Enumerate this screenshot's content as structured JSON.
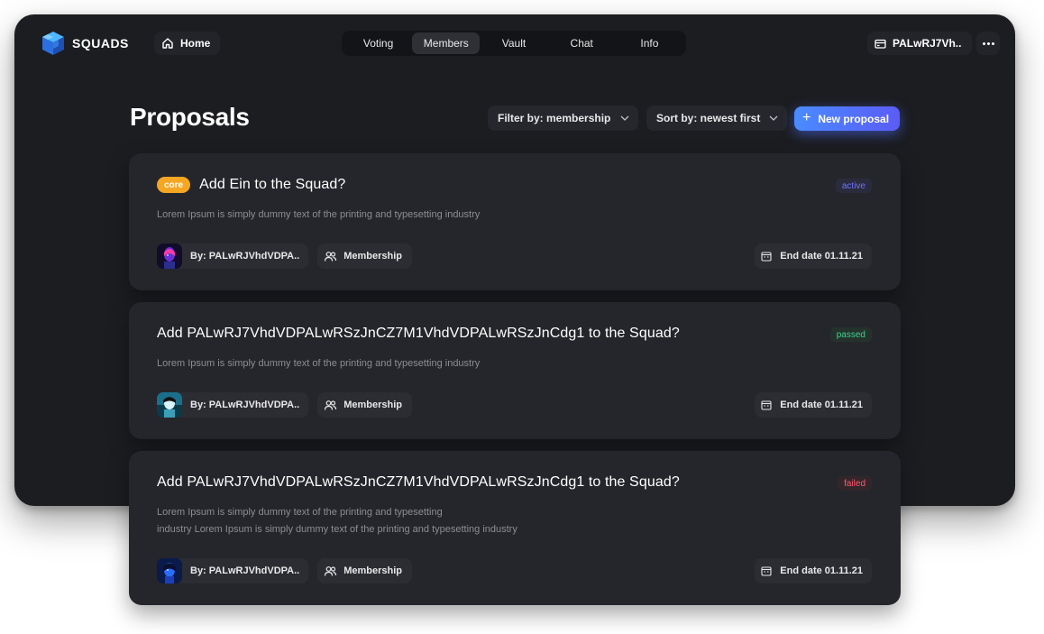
{
  "header": {
    "logo_text": "SQUADS",
    "home_label": "Home",
    "tabs": [
      {
        "label": "Voting"
      },
      {
        "label": "Members"
      },
      {
        "label": "Vault"
      },
      {
        "label": "Chat"
      },
      {
        "label": "Info"
      }
    ],
    "active_tab": "Members",
    "wallet_label": "PALwRJ7Vh.."
  },
  "page": {
    "title": "Proposals",
    "filter_label": "Filter by: membership",
    "sort_label": "Sort by: newest first",
    "new_button_label": "New proposal"
  },
  "proposals": [
    {
      "tag": "core",
      "title": "Add Ein to the Squad?",
      "status": "active",
      "description": [
        "Lorem Ipsum is simply dummy text of the printing and typesetting industry"
      ],
      "author": "By: PALwRJVhdVDPA..",
      "type": "Membership",
      "end_date": "End date 01.11.21"
    },
    {
      "title": "Add PALwRJ7VhdVDPALwRSzJnCZ7M1VhdVDPALwRSzJnCdg1 to the Squad?",
      "status": "passed",
      "description": [
        "Lorem Ipsum is simply dummy text of the printing and typesetting industry"
      ],
      "author": "By: PALwRJVhdVDPA..",
      "type": "Membership",
      "end_date": "End date 01.11.21"
    },
    {
      "title": "Add PALwRJ7VhdVDPALwRSzJnCZ7M1VhdVDPALwRSzJnCdg1 to the Squad?",
      "status": "failed",
      "description": [
        "Lorem Ipsum is simply dummy text of the printing and typesetting",
        "industry Lorem Ipsum is simply dummy text of the printing and typesetting industry"
      ],
      "author": "By: PALwRJVhdVDPA..",
      "type": "Membership",
      "end_date": "End date 01.11.21"
    }
  ],
  "colors": {
    "background": "#1c1d21",
    "card": "#25262b",
    "accent": "#4a8bff",
    "core_tag": "#f5a623",
    "status_active": "#6d74ff",
    "status_passed": "#3dd28a",
    "status_failed": "#ff5a6e"
  }
}
